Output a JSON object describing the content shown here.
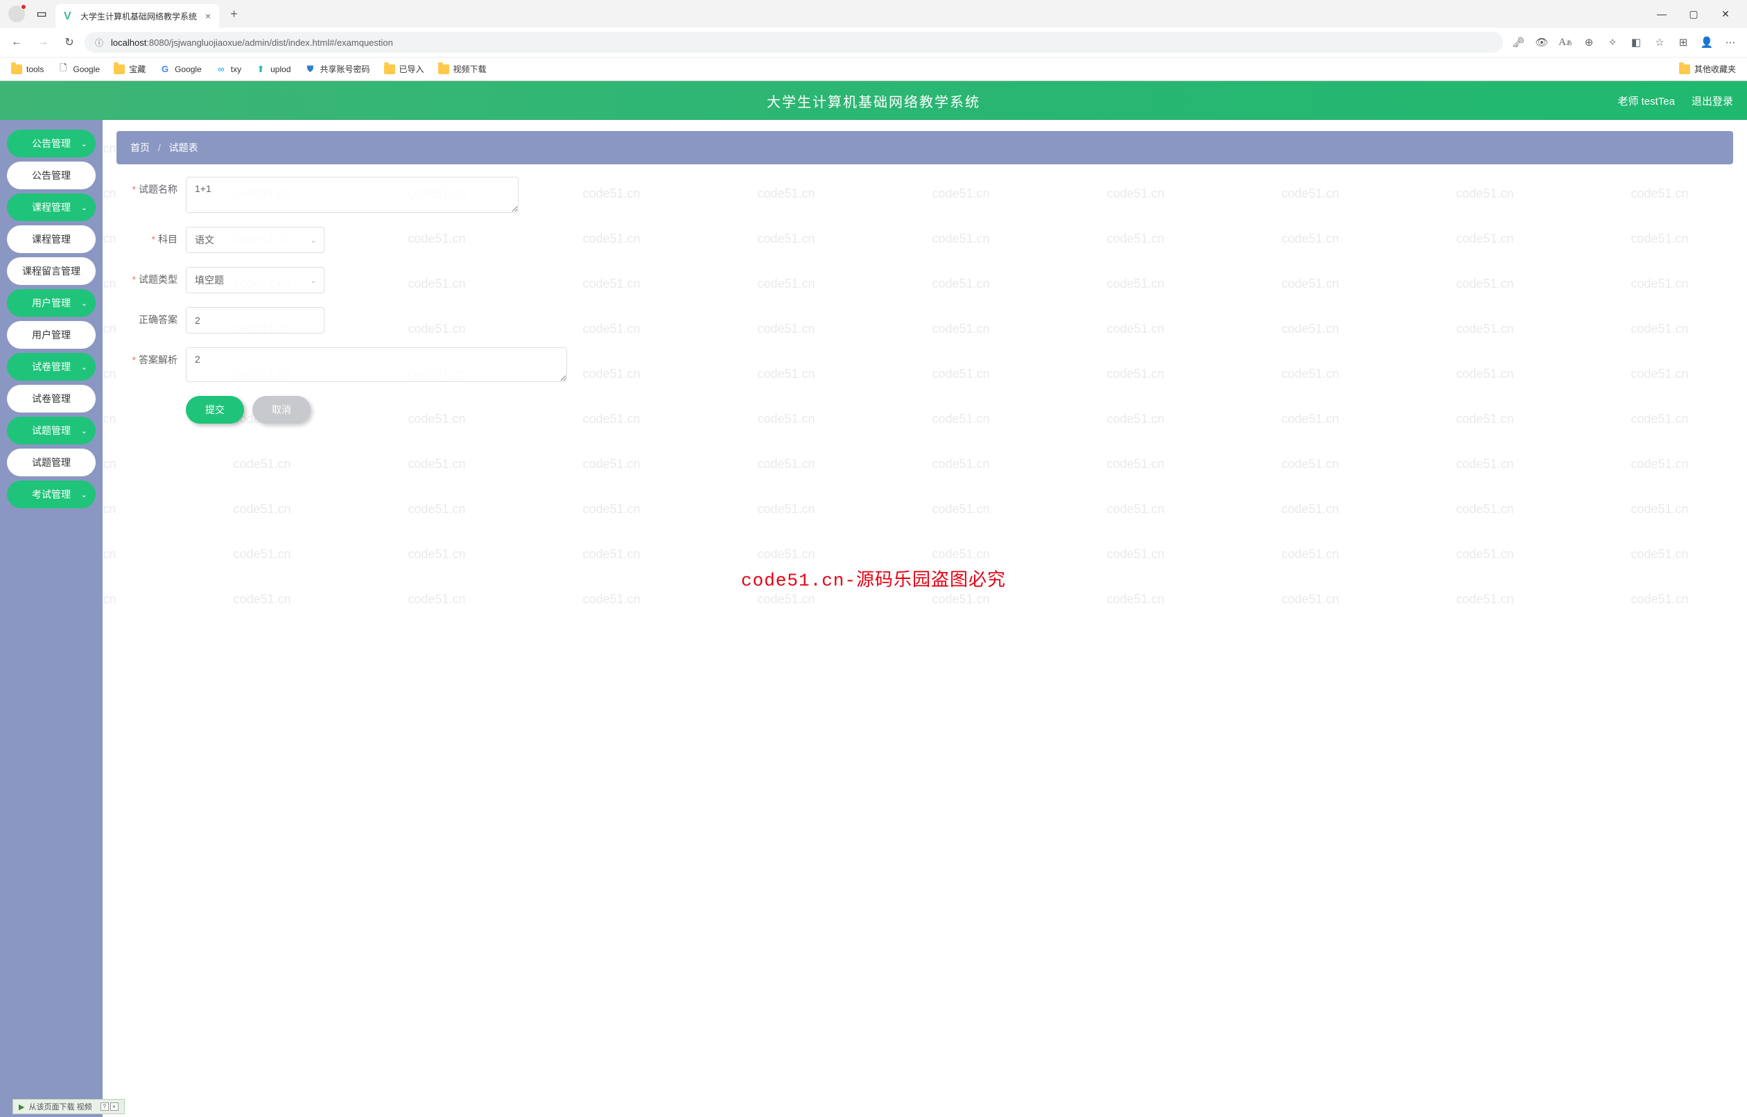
{
  "browser": {
    "tab_title": "大学生计算机基础网络教学系统",
    "url_host": "localhost",
    "url_path": ":8080/jsjwangluojiaoxue/admin/dist/index.html#/examquestion",
    "bookmarks": [
      "tools",
      "Google",
      "宝藏",
      "Google",
      "txy",
      "uplod",
      "共享账号密码",
      "已导入",
      "视频下载"
    ],
    "other_bookmarks": "其他收藏夹"
  },
  "app": {
    "title": "大学生计算机基础网络教学系统",
    "user_label": "老师 testTea",
    "logout": "退出登录"
  },
  "sidebar": [
    {
      "label": "公告管理",
      "type": "parent"
    },
    {
      "label": "公告管理",
      "type": "child"
    },
    {
      "label": "课程管理",
      "type": "parent"
    },
    {
      "label": "课程管理",
      "type": "child"
    },
    {
      "label": "课程留言管理",
      "type": "child"
    },
    {
      "label": "用户管理",
      "type": "parent"
    },
    {
      "label": "用户管理",
      "type": "child"
    },
    {
      "label": "试卷管理",
      "type": "parent"
    },
    {
      "label": "试卷管理",
      "type": "child"
    },
    {
      "label": "试题管理",
      "type": "parent"
    },
    {
      "label": "试题管理",
      "type": "child"
    },
    {
      "label": "考试管理",
      "type": "parent"
    }
  ],
  "breadcrumb": {
    "home": "首页",
    "current": "试题表"
  },
  "form": {
    "question_name": {
      "label": "试题名称",
      "value": "1+1"
    },
    "subject": {
      "label": "科目",
      "value": "语文"
    },
    "question_type": {
      "label": "试题类型",
      "value": "填空题"
    },
    "correct_answer": {
      "label": "正确答案",
      "value": "2"
    },
    "answer_analysis": {
      "label": "答案解析",
      "value": "2"
    },
    "submit": "提交",
    "cancel": "取消"
  },
  "watermark": "code51.cn",
  "watermark_center": "code51.cn-源码乐园盗图必究",
  "download_hint": "从该页面下载 视频"
}
